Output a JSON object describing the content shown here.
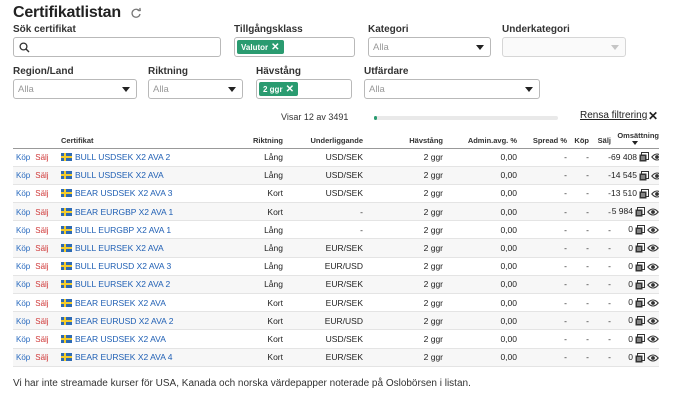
{
  "page": {
    "title": "Certifikatlistan"
  },
  "filters": {
    "search_label": "Sök certifikat",
    "asset_class_label": "Tillgångsklass",
    "asset_class_chip": "Valutor",
    "category_label": "Kategori",
    "category_value": "Alla",
    "subcategory_label": "Underkategori",
    "region_label": "Region/Land",
    "region_value": "Alla",
    "direction_label": "Riktning",
    "direction_value": "Alla",
    "leverage_label": "Hävstång",
    "leverage_chip": "2 ggr",
    "issuer_label": "Utfärdare",
    "issuer_value": "Alla"
  },
  "results": {
    "showing_text": "Visar 12 av 3491",
    "progress_fraction": 0.0034,
    "clear_filters": "Rensa filtrering"
  },
  "table": {
    "headers": {
      "certificate": "Certifikat",
      "direction": "Riktning",
      "underlying": "Underliggande",
      "leverage": "Hävstång",
      "admin_fee": "Admin.avg. %",
      "spread": "Spread %",
      "buy": "Köp",
      "sell": "Sälj",
      "turnover": "Omsättning"
    },
    "buy_label": "Köp",
    "sell_label": "Sälj",
    "rows": [
      {
        "name": "BULL USDSEK X2 AVA 2",
        "direction": "Lång",
        "underlying": "USD/SEK",
        "leverage": "2 ggr",
        "admin_fee": "0,00",
        "spread": "-",
        "buy": "-",
        "sell": "-",
        "turnover": "69 408"
      },
      {
        "name": "BULL USDSEK X2 AVA",
        "direction": "Lång",
        "underlying": "USD/SEK",
        "leverage": "2 ggr",
        "admin_fee": "0,00",
        "spread": "-",
        "buy": "-",
        "sell": "-",
        "turnover": "14 545"
      },
      {
        "name": "BEAR USDSEK X2 AVA 3",
        "direction": "Kort",
        "underlying": "USD/SEK",
        "leverage": "2 ggr",
        "admin_fee": "0,00",
        "spread": "-",
        "buy": "-",
        "sell": "-",
        "turnover": "13 510"
      },
      {
        "name": "BEAR EURGBP X2 AVA 1",
        "direction": "Kort",
        "underlying": "-",
        "leverage": "2 ggr",
        "admin_fee": "0,00",
        "spread": "-",
        "buy": "-",
        "sell": "-",
        "turnover": "5 984"
      },
      {
        "name": "BULL EURGBP X2 AVA 1",
        "direction": "Lång",
        "underlying": "-",
        "leverage": "2 ggr",
        "admin_fee": "0,00",
        "spread": "-",
        "buy": "-",
        "sell": "-",
        "turnover": "0"
      },
      {
        "name": "BULL EURSEK X2 AVA",
        "direction": "Lång",
        "underlying": "EUR/SEK",
        "leverage": "2 ggr",
        "admin_fee": "0,00",
        "spread": "-",
        "buy": "-",
        "sell": "-",
        "turnover": "0"
      },
      {
        "name": "BULL EURUSD X2 AVA 3",
        "direction": "Lång",
        "underlying": "EUR/USD",
        "leverage": "2 ggr",
        "admin_fee": "0,00",
        "spread": "-",
        "buy": "-",
        "sell": "-",
        "turnover": "0"
      },
      {
        "name": "BULL EURSEK X2 AVA 2",
        "direction": "Lång",
        "underlying": "EUR/SEK",
        "leverage": "2 ggr",
        "admin_fee": "0,00",
        "spread": "-",
        "buy": "-",
        "sell": "-",
        "turnover": "0"
      },
      {
        "name": "BEAR EURSEK X2 AVA",
        "direction": "Kort",
        "underlying": "EUR/SEK",
        "leverage": "2 ggr",
        "admin_fee": "0,00",
        "spread": "-",
        "buy": "-",
        "sell": "-",
        "turnover": "0"
      },
      {
        "name": "BEAR EURUSD X2 AVA 2",
        "direction": "Kort",
        "underlying": "EUR/USD",
        "leverage": "2 ggr",
        "admin_fee": "0,00",
        "spread": "-",
        "buy": "-",
        "sell": "-",
        "turnover": "0"
      },
      {
        "name": "BEAR USDSEK X2 AVA",
        "direction": "Kort",
        "underlying": "USD/SEK",
        "leverage": "2 ggr",
        "admin_fee": "0,00",
        "spread": "-",
        "buy": "-",
        "sell": "-",
        "turnover": "0"
      },
      {
        "name": "BEAR EURSEK X2 AVA 4",
        "direction": "Kort",
        "underlying": "EUR/SEK",
        "leverage": "2 ggr",
        "admin_fee": "0,00",
        "spread": "-",
        "buy": "-",
        "sell": "-",
        "turnover": "0"
      }
    ]
  },
  "footer": {
    "note": "Vi har inte streamade kurser för USA, Kanada och norska värdepapper noterade på Oslobörsen i listan."
  },
  "colors": {
    "accent_green": "#2a9b70",
    "link_blue": "#1f5fb4",
    "sell_red": "#d03a3a"
  },
  "icons": {
    "refresh": "refresh-icon",
    "search": "search-icon",
    "chevron": "chevron-down-icon",
    "chip_remove": "close-icon",
    "flag": "swedish-flag-icon",
    "row_doc": "document-icon",
    "row_watch": "eye-icon"
  }
}
